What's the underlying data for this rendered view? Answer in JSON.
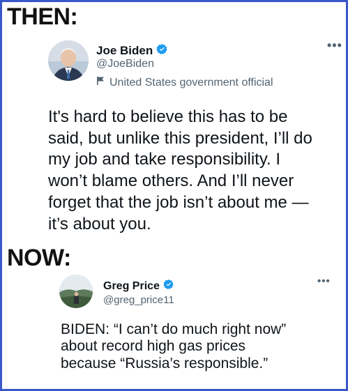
{
  "headings": {
    "then": "THEN:",
    "now": "NOW:"
  },
  "tweet1": {
    "name": "Joe Biden",
    "handle": "@JoeBiden",
    "label": "United States government official",
    "more": "•••",
    "text_lines": [
      "It's hard to believe this has to be",
      "said, but unlike this president, I’ll do",
      "my job and take responsibility. I",
      "won’t blame others. And I’ll never",
      "forget that the job isn’t about me —",
      "it’s about you."
    ]
  },
  "tweet2": {
    "name": "Greg Price",
    "handle": "@greg_price11",
    "more": "•••",
    "text_lines": [
      "BIDEN: “I can’t do much right now”",
      "about record high gas prices",
      "because “Russia’s responsible.”"
    ]
  },
  "colors": {
    "frame_border": "#3a57c9",
    "verified_badge": "#1d9bf0",
    "secondary_text": "#536471"
  },
  "icons": {
    "verified": "verified-badge-icon",
    "label": "flag-icon",
    "more": "more-options-icon"
  }
}
